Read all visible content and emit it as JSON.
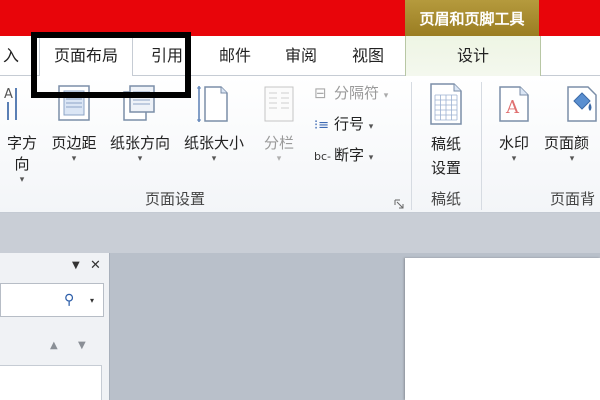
{
  "title_bar": {
    "context_tab_group": "页眉和页脚工具"
  },
  "tabs": {
    "insert_partial": "入",
    "page_layout": "页面布局",
    "references": "引用",
    "mailings": "邮件",
    "review": "审阅",
    "view": "视图",
    "design": "设计"
  },
  "ribbon": {
    "page_setup": {
      "text_direction_partial": "字方向",
      "margins": "页边距",
      "orientation": "纸张方向",
      "size": "纸张大小",
      "columns": "分栏",
      "breaks": "分隔符",
      "line_numbers": "行号",
      "hyphenation": "断字",
      "group_label": "页面设置"
    },
    "manuscript": {
      "manuscript_settings": [
        "稿纸",
        "设置"
      ],
      "group_label": "稿纸"
    },
    "page_background": {
      "watermark": "水印",
      "page_color_partial": "页面颜",
      "group_label_partial": "页面背"
    }
  },
  "nav_pane": {
    "close_glyph": "✕",
    "dropdown_glyph": "▼",
    "search_glyph": "⚲"
  },
  "colors": {
    "title_bar": "#e8050a",
    "context_group": "#a88a2c",
    "ribbon_bg": "#f3f5f8"
  }
}
